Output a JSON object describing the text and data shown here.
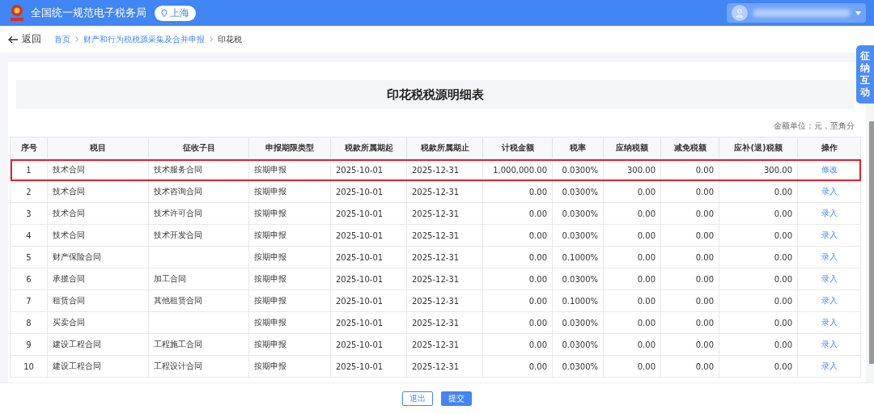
{
  "header": {
    "title": "全国统一规范电子税务局",
    "region": "上海"
  },
  "nav": {
    "back": "返回",
    "breadcrumb": [
      {
        "label": "首页",
        "current": false
      },
      {
        "label": "财产和行为税税源采集及合并申报",
        "current": false
      },
      {
        "label": "印花税",
        "current": true
      }
    ]
  },
  "side_tab": "征纳互动",
  "panel": {
    "title": "印花税税源明细表",
    "unit_note": "金额单位：元，至角分"
  },
  "table": {
    "columns": [
      "序号",
      "税目",
      "征收子目",
      "申报期限类型",
      "税款所属期起",
      "税款所属期止",
      "计税金额",
      "税率",
      "应纳税额",
      "减免税额",
      "应补(退)税额",
      "操作"
    ],
    "rows": [
      {
        "cells": [
          "1",
          "技术合同",
          "技术服务合同",
          "按期申报",
          "2025-10-01",
          "2025-12-31",
          "1,000,000.00",
          "0.0300%",
          "300.00",
          "0.00",
          "300.00"
        ],
        "action": "修改",
        "highlighted": true
      },
      {
        "cells": [
          "2",
          "技术合同",
          "技术咨询合同",
          "按期申报",
          "2025-10-01",
          "2025-12-31",
          "0.00",
          "0.0300%",
          "0.00",
          "0.00",
          "0.00"
        ],
        "action": "录入",
        "highlighted": false
      },
      {
        "cells": [
          "3",
          "技术合同",
          "技术许可合同",
          "按期申报",
          "2025-10-01",
          "2025-12-31",
          "0.00",
          "0.0300%",
          "0.00",
          "0.00",
          "0.00"
        ],
        "action": "录入",
        "highlighted": false
      },
      {
        "cells": [
          "4",
          "技术合同",
          "技术开发合同",
          "按期申报",
          "2025-10-01",
          "2025-12-31",
          "0.00",
          "0.0300%",
          "0.00",
          "0.00",
          "0.00"
        ],
        "action": "录入",
        "highlighted": false
      },
      {
        "cells": [
          "5",
          "财产保险合同",
          "",
          "按期申报",
          "2025-10-01",
          "2025-12-31",
          "0.00",
          "0.1000%",
          "0.00",
          "0.00",
          "0.00"
        ],
        "action": "录入",
        "highlighted": false
      },
      {
        "cells": [
          "6",
          "承揽合同",
          "加工合同",
          "按期申报",
          "2025-10-01",
          "2025-12-31",
          "0.00",
          "0.0300%",
          "0.00",
          "0.00",
          "0.00"
        ],
        "action": "录入",
        "highlighted": false
      },
      {
        "cells": [
          "7",
          "租赁合同",
          "其他租赁合同",
          "按期申报",
          "2025-10-01",
          "2025-12-31",
          "0.00",
          "0.1000%",
          "0.00",
          "0.00",
          "0.00"
        ],
        "action": "录入",
        "highlighted": false
      },
      {
        "cells": [
          "8",
          "买卖合同",
          "",
          "按期申报",
          "2025-10-01",
          "2025-12-31",
          "0.00",
          "0.0300%",
          "0.00",
          "0.00",
          "0.00"
        ],
        "action": "录入",
        "highlighted": false
      },
      {
        "cells": [
          "9",
          "建设工程合同",
          "工程施工合同",
          "按期申报",
          "2025-10-01",
          "2025-12-31",
          "0.00",
          "0.0300%",
          "0.00",
          "0.00",
          "0.00"
        ],
        "action": "录入",
        "highlighted": false
      },
      {
        "cells": [
          "10",
          "建设工程合同",
          "工程设计合同",
          "按期申报",
          "2025-10-01",
          "2025-12-31",
          "0.00",
          "0.0300%",
          "0.00",
          "0.00",
          "0.00"
        ],
        "action": "录入",
        "highlighted": false
      }
    ]
  },
  "footer": {
    "buttons": [
      {
        "label": "退出",
        "primary": false
      },
      {
        "label": "提交",
        "primary": true
      }
    ]
  }
}
